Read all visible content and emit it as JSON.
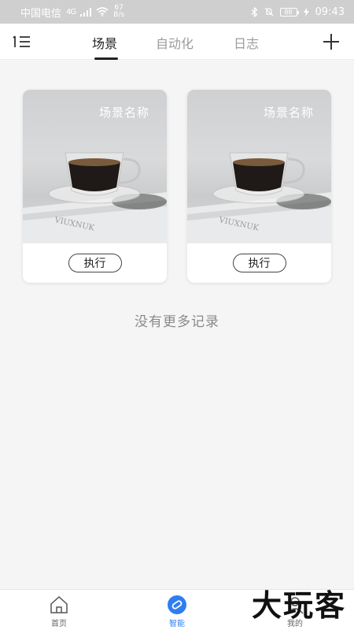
{
  "status_bar": {
    "carrier": "中国电信",
    "network": "4G",
    "speed_value": "67",
    "speed_unit": "B/s",
    "battery": "88",
    "time": "09:43"
  },
  "header": {
    "tabs": [
      {
        "label": "场景",
        "active": true
      },
      {
        "label": "自动化",
        "active": false
      },
      {
        "label": "日志",
        "active": false
      }
    ]
  },
  "scenes": [
    {
      "title": "场景名称",
      "button_label": "执行"
    },
    {
      "title": "场景名称",
      "button_label": "执行"
    }
  ],
  "list_footer": "没有更多记录",
  "bottom_nav": {
    "items": [
      {
        "label": "首页",
        "icon": "home-icon",
        "active": false
      },
      {
        "label": "智能",
        "icon": "smart-icon",
        "active": true
      },
      {
        "label": "我的",
        "icon": "profile-icon",
        "active": false
      }
    ]
  },
  "watermark": "大玩客",
  "colors": {
    "accent": "#2f7ef0",
    "background": "#f5f5f5",
    "status_bar": "#cfcfcf"
  }
}
